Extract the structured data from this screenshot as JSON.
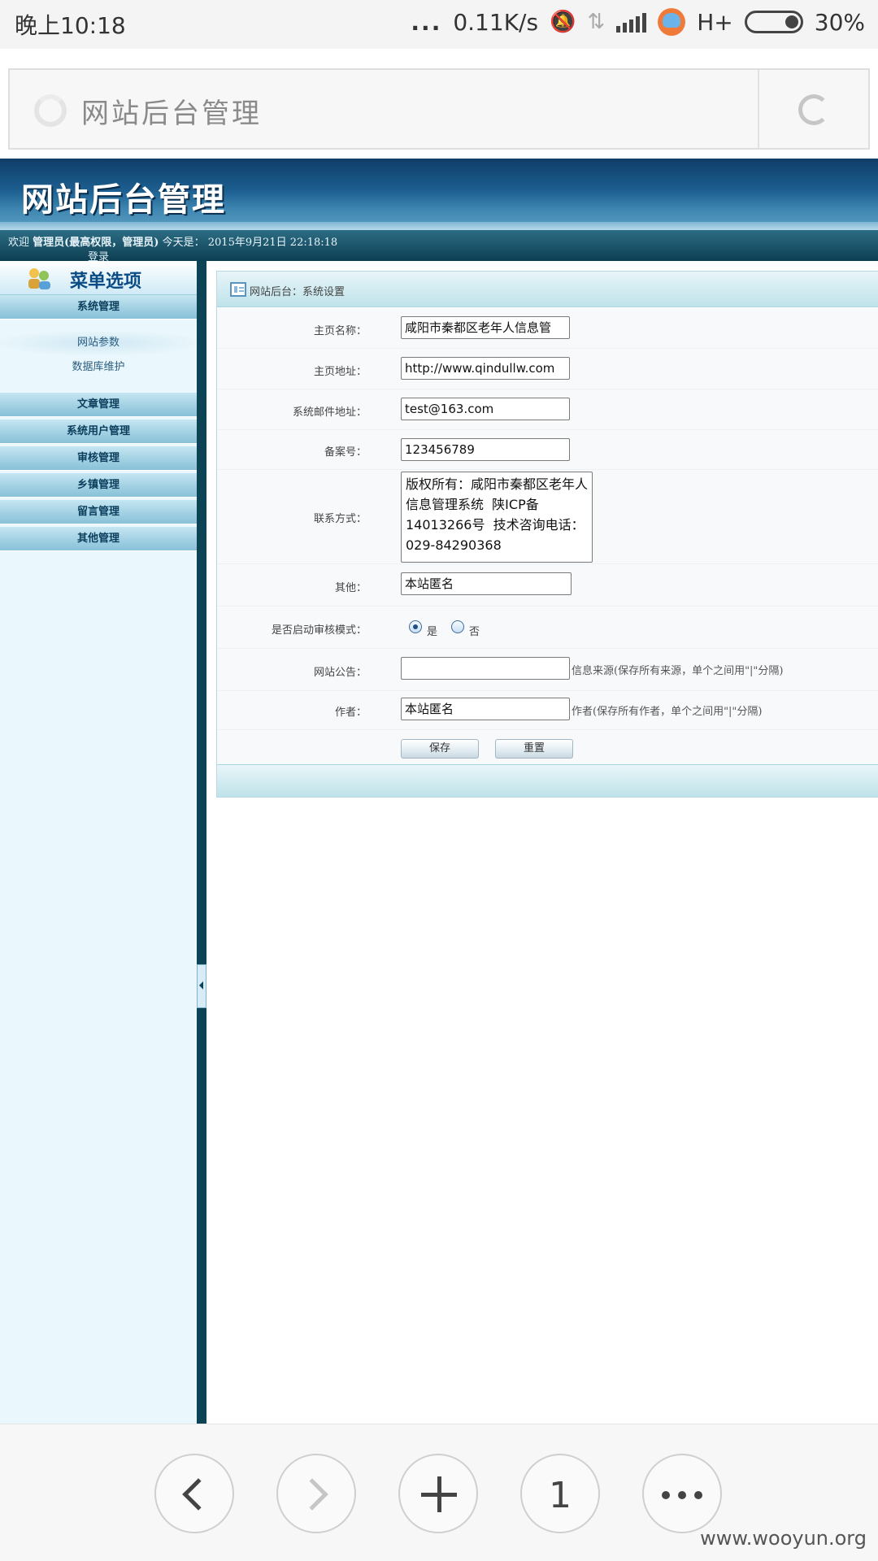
{
  "status_bar": {
    "time": "晚上10:18",
    "dots": "...",
    "net_speed": "0.11K/s",
    "network_type": "H+",
    "battery": "30%",
    "icons": [
      "mute-bell-icon",
      "data-arrows-icon",
      "signal-bars-icon",
      "app-bunny-icon",
      "battery-icon"
    ]
  },
  "browser": {
    "address_title": "网站后台管理",
    "tab_count": "1",
    "icons": [
      "loading-circle-icon",
      "reload-icon",
      "back-icon",
      "forward-icon",
      "new-tab-icon",
      "more-icon"
    ]
  },
  "site": {
    "logo": "网站后台管理",
    "welcome_prefix": "欢迎",
    "user": "管理员(最高权限，管理员)",
    "today_label": "今天是：",
    "datetime": "2015年9月21日 22:18:18",
    "login": "登录"
  },
  "sidebar": {
    "title": "菜单选项",
    "system_menu": "系统管理",
    "sub_items": [
      {
        "label": "网站参数"
      },
      {
        "label": "数据库维护"
      }
    ],
    "menus": [
      {
        "label": "文章管理"
      },
      {
        "label": "系统用户管理"
      },
      {
        "label": "审核管理"
      },
      {
        "label": "乡镇管理"
      },
      {
        "label": "留言管理"
      },
      {
        "label": "其他管理"
      }
    ]
  },
  "panel": {
    "breadcrumb": "网站后台：系统设置",
    "fields": {
      "home_name": {
        "label": "主页名称：",
        "value": "咸阳市秦都区老年人信息管"
      },
      "home_url": {
        "label": "主页地址：",
        "value": "http://www.qindullw.com"
      },
      "email": {
        "label": "系统邮件地址：",
        "value": "test@163.com"
      },
      "icp": {
        "label": "备案号：",
        "value": "123456789"
      },
      "contact": {
        "label": "联系方式：",
        "value": "版权所有：咸阳市秦都区老年人信息管理系统  陕ICP备14013266号  技术咨询电话：029-84290368"
      },
      "other": {
        "label": "其他：",
        "value": "本站匿名"
      },
      "audit": {
        "label": "是否启动审核模式：",
        "yes": "是",
        "no": "否"
      },
      "notice": {
        "label": "网站公告：",
        "value": "",
        "hint": "信息来源(保存所有来源，单个之间用\"|\"分隔)"
      },
      "author": {
        "label": "作者：",
        "value": "本站匿名",
        "hint": "作者(保存所有作者，单个之间用\"|\"分隔)"
      }
    },
    "buttons": {
      "save": "保存",
      "reset": "重置"
    }
  },
  "watermark": "www.wooyun.org"
}
